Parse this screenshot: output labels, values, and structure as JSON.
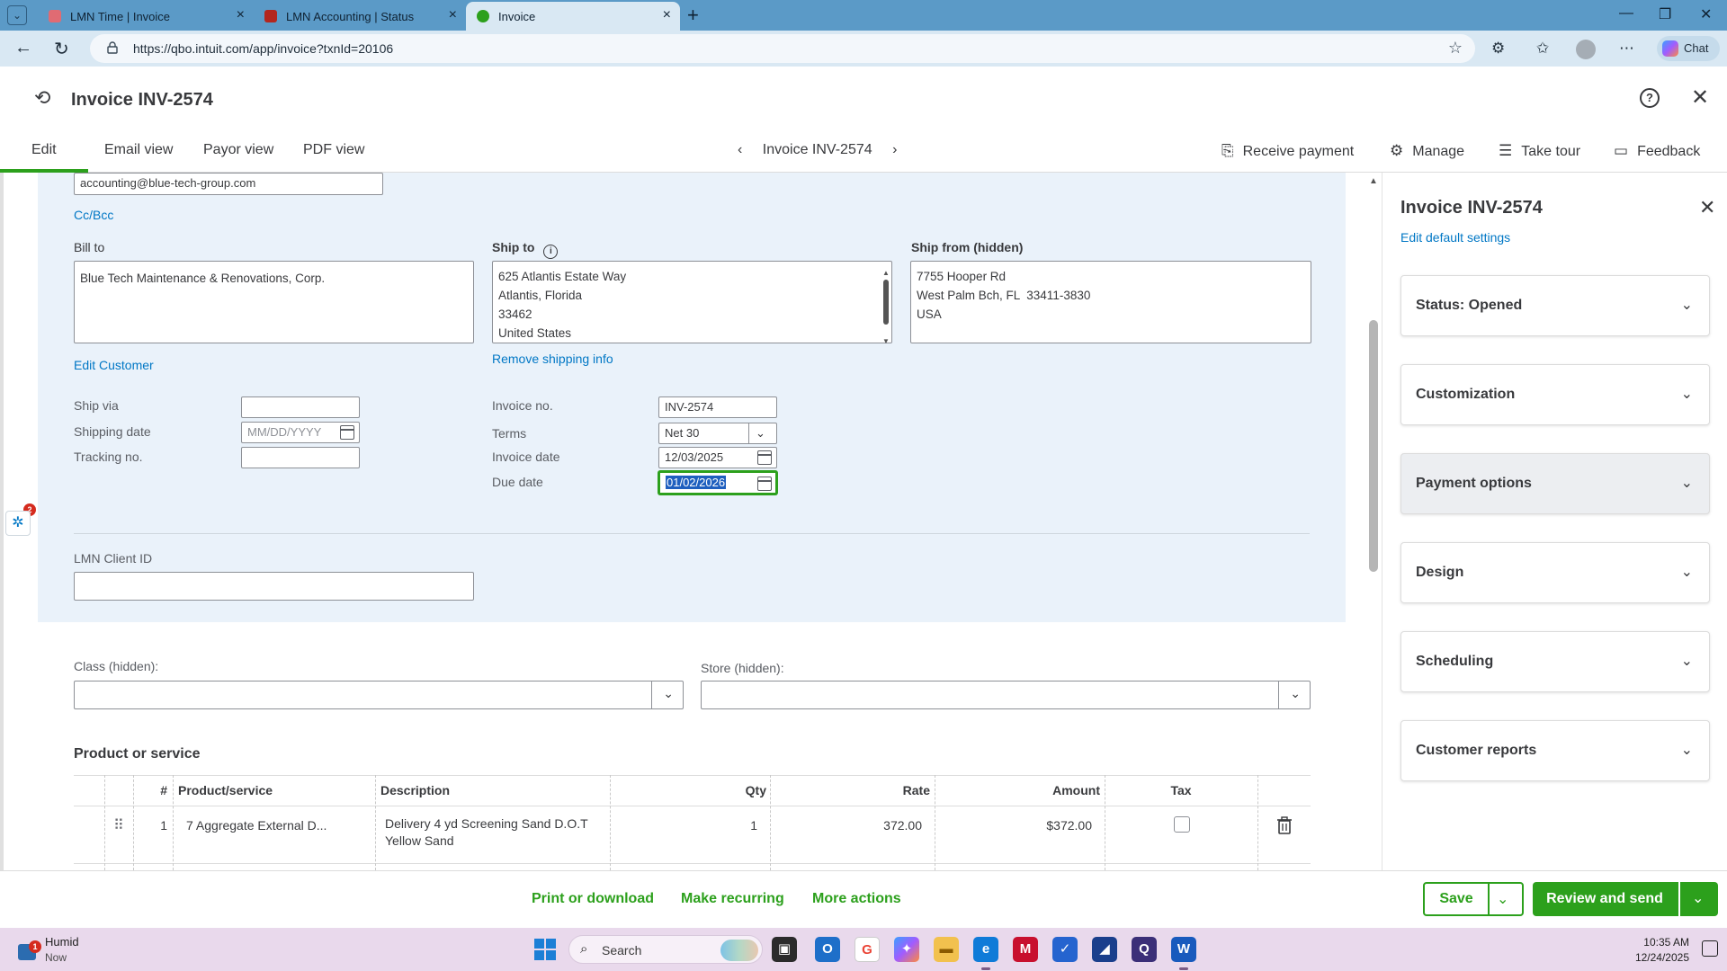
{
  "browser": {
    "tabs": [
      {
        "title": "LMN Time | Invoice",
        "color": "#e06b73"
      },
      {
        "title": "LMN Accounting | Status",
        "color": "#b3261e"
      },
      {
        "title": "Invoice",
        "color": "#2ca01c"
      }
    ],
    "url": "https://qbo.intuit.com/app/invoice?txnId=20106",
    "chat_label": "Chat"
  },
  "header": {
    "title": "Invoice INV-2574"
  },
  "subnav": {
    "tabs": [
      "Edit",
      "Email view",
      "Payor view",
      "PDF view"
    ],
    "center_title": "Invoice INV-2574",
    "actions": {
      "receive_payment": "Receive payment",
      "manage": "Manage",
      "take_tour": "Take tour",
      "feedback": "Feedback"
    }
  },
  "form": {
    "email": "accounting@blue-tech-group.com",
    "cc_bcc": "Cc/Bcc",
    "bill_to_label": "Bill to",
    "bill_to_value": "Blue Tech Maintenance & Renovations, Corp.",
    "ship_to_label": "Ship to",
    "ship_to_lines": [
      "625 Atlantis Estate Way",
      "Atlantis, Florida",
      "33462",
      "United States"
    ],
    "ship_from_label": "Ship from (hidden)",
    "ship_from_lines": [
      "7755 Hooper Rd",
      "West Palm Bch, FL  33411-3830",
      "USA"
    ],
    "edit_customer": "Edit Customer",
    "remove_shipping": "Remove shipping info",
    "ship_via_label": "Ship via",
    "shipping_date_label": "Shipping date",
    "shipping_date_placeholder": "MM/DD/YYYY",
    "tracking_label": "Tracking no.",
    "invoice_no_label": "Invoice no.",
    "invoice_no_value": "INV-2574",
    "terms_label": "Terms",
    "terms_value": "Net 30",
    "invoice_date_label": "Invoice date",
    "invoice_date_value": "12/03/2025",
    "due_date_label": "Due date",
    "due_date_value": "01/02/2026",
    "lmn_client_label": "LMN Client ID",
    "class_label": "Class (hidden):",
    "store_label": "Store (hidden):",
    "notification_count": "2"
  },
  "products": {
    "title": "Product or service",
    "columns": [
      "#",
      "Product/service",
      "Description",
      "Qty",
      "Rate",
      "Amount",
      "Tax"
    ],
    "rows": [
      {
        "num": "1",
        "product": "7 Aggregate External D...",
        "description_l1": "Delivery 4 yd Screening Sand D.O.T",
        "description_l2": "Yellow Sand",
        "qty": "1",
        "rate": "372.00",
        "amount": "$372.00",
        "tax": false
      }
    ]
  },
  "drawer": {
    "title": "Invoice INV-2574",
    "edit_defaults": "Edit default settings",
    "sections": [
      "Status: Opened",
      "Customization",
      "Payment options",
      "Design",
      "Scheduling",
      "Customer reports"
    ]
  },
  "footer": {
    "print": "Print or download",
    "recurring": "Make recurring",
    "more": "More actions",
    "save": "Save",
    "review_send": "Review and send"
  },
  "taskbar": {
    "weather_title": "Humid",
    "weather_sub": "Now",
    "weather_badge": "1",
    "search_label": "Search",
    "time": "10:35 AM",
    "date": "12/24/2025"
  },
  "colors": {
    "accent_green": "#2ca01c",
    "link_blue": "#0077c5",
    "panel_bg": "#eaf2fa"
  }
}
